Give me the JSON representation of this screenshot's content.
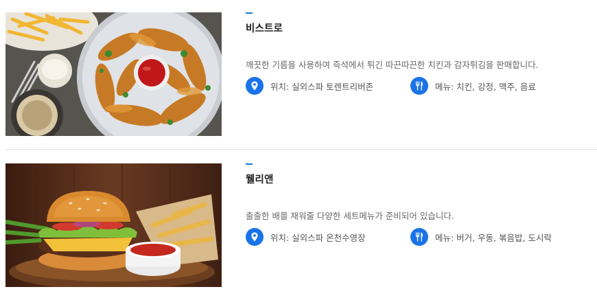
{
  "colors": {
    "accent": "#1a73d9",
    "icon_bg": "#1a73e8",
    "text_muted": "#666666",
    "divider": "#e3e3e3"
  },
  "restaurants": [
    {
      "name": "비스트로",
      "description": "깨끗한 기름을 사용하여 즉석에서 튀긴 따끈따끈한 치킨과 감자튀김을 판매합니다.",
      "location": "위치: 실외스파 토렌트리버존",
      "menu": "메뉴: 치킨, 강정, 맥주, 음료",
      "location_icon": "location-pin-icon",
      "menu_icon": "fork-knife-icon"
    },
    {
      "name": "웰리앤",
      "description": "출출한 배를 채워줄 다양한 세트메뉴가 준비되어 있습니다.",
      "location": "위치: 실외스파 온천수영장",
      "menu": "메뉴: 버거, 우동, 볶음밥, 도시락",
      "location_icon": "location-pin-icon",
      "menu_icon": "fork-knife-icon"
    }
  ]
}
